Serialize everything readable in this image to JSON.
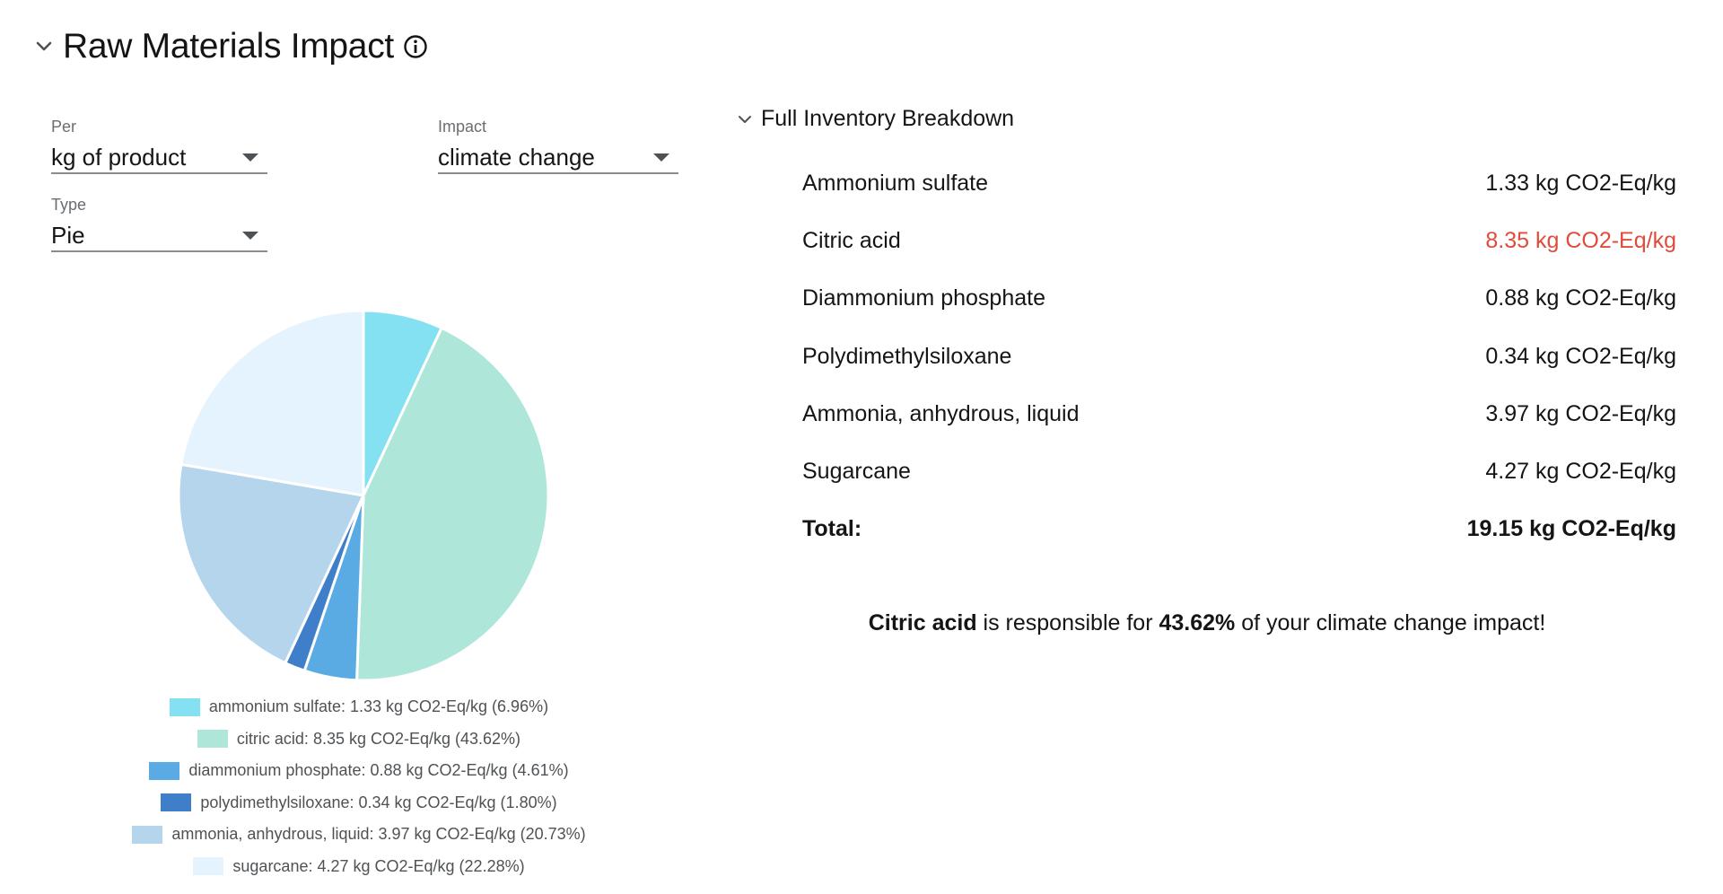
{
  "header": {
    "title": "Raw Materials Impact"
  },
  "controls": {
    "per": {
      "label": "Per",
      "value": "kg of product"
    },
    "impact": {
      "label": "Impact",
      "value": "climate change"
    },
    "type": {
      "label": "Type",
      "value": "Pie"
    }
  },
  "colors": {
    "highlight_red": "#e04b3c",
    "ammonium_sulfate": "#84e1f1",
    "citric_acid": "#aee6d9",
    "diammonium_phosphate": "#5aabe4",
    "polydimethylsiloxane": "#3f7fca",
    "ammonia": "#b4d5ec",
    "sugarcane": "#e4f3fd"
  },
  "chart_data": {
    "type": "pie",
    "title": "",
    "slices": [
      {
        "name": "ammonium sulfate",
        "value": 1.33,
        "percent": 6.96,
        "color": "#84e1f1",
        "legend": "ammonium sulfate: 1.33 kg CO2-Eq/kg (6.96%)"
      },
      {
        "name": "citric acid",
        "value": 8.35,
        "percent": 43.62,
        "color": "#aee6d9",
        "legend": "citric acid: 8.35 kg CO2-Eq/kg (43.62%)"
      },
      {
        "name": "diammonium phosphate",
        "value": 0.88,
        "percent": 4.61,
        "color": "#5aabe4",
        "legend": "diammonium phosphate: 0.88 kg CO2-Eq/kg (4.61%)"
      },
      {
        "name": "polydimethylsiloxane",
        "value": 0.34,
        "percent": 1.8,
        "color": "#3f7fca",
        "legend": "polydimethylsiloxane: 0.34 kg CO2-Eq/kg (1.80%)"
      },
      {
        "name": "ammonia, anhydrous, liquid",
        "value": 3.97,
        "percent": 20.73,
        "color": "#b4d5ec",
        "legend": "ammonia, anhydrous, liquid: 3.97 kg CO2-Eq/kg (20.73%)"
      },
      {
        "name": "sugarcane",
        "value": 4.27,
        "percent": 22.28,
        "color": "#e4f3fd",
        "legend": "sugarcane: 4.27 kg CO2-Eq/kg (22.28%)"
      }
    ]
  },
  "breakdown": {
    "title": "Full Inventory Breakdown",
    "rows": [
      {
        "name": "Ammonium sulfate",
        "value": "1.33 kg CO2-Eq/kg",
        "highlight": false
      },
      {
        "name": "Citric acid",
        "value": "8.35 kg CO2-Eq/kg",
        "highlight": true
      },
      {
        "name": "Diammonium phosphate",
        "value": "0.88 kg CO2-Eq/kg",
        "highlight": false
      },
      {
        "name": "Polydimethylsiloxane",
        "value": "0.34 kg CO2-Eq/kg",
        "highlight": false
      },
      {
        "name": "Ammonia, anhydrous, liquid",
        "value": "3.97 kg CO2-Eq/kg",
        "highlight": false
      },
      {
        "name": "Sugarcane",
        "value": "4.27 kg CO2-Eq/kg",
        "highlight": false
      }
    ],
    "total": {
      "label": "Total:",
      "value": "19.15 kg CO2-Eq/kg"
    }
  },
  "summary": {
    "material": "Citric acid",
    "text_mid": " is responsible for ",
    "percent": "43.62%",
    "text_end": " of your climate change impact!"
  },
  "icons": {
    "header_caret": "chevron-down-icon",
    "info": "info-circle-icon",
    "breakdown_caret": "chevron-down-icon"
  }
}
